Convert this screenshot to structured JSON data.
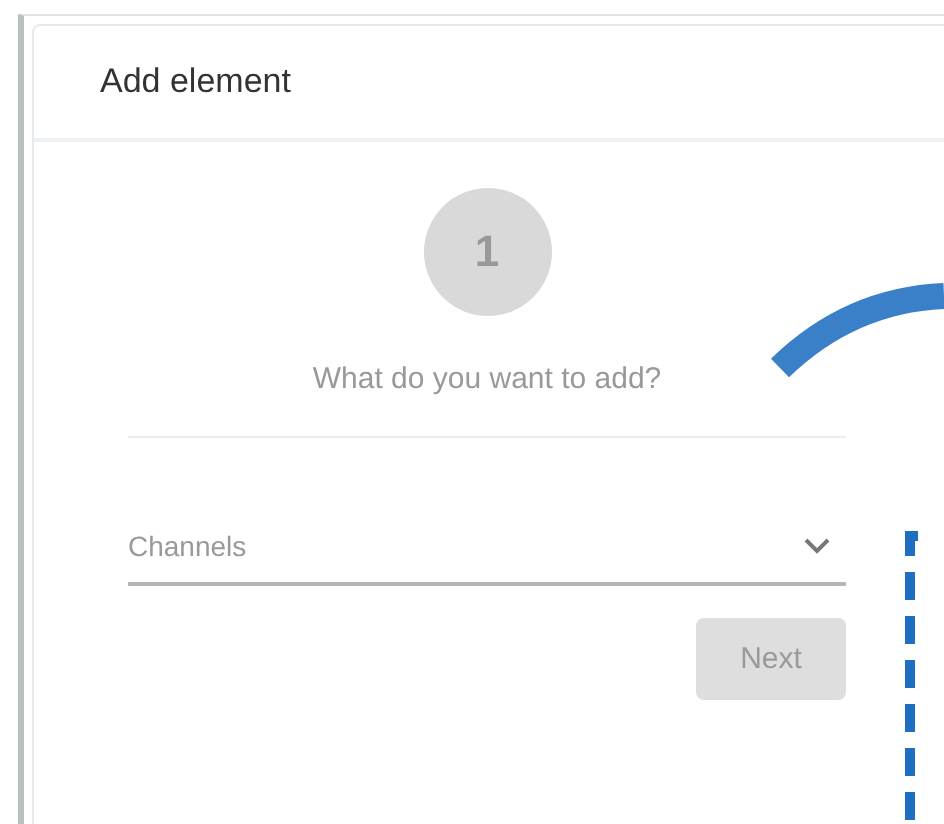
{
  "dialog": {
    "title": "Add element"
  },
  "step": {
    "number": "1",
    "question": "What do you want to add?"
  },
  "dropdown": {
    "value": "Channels"
  },
  "next_button": {
    "label": "Next",
    "disabled": true
  }
}
